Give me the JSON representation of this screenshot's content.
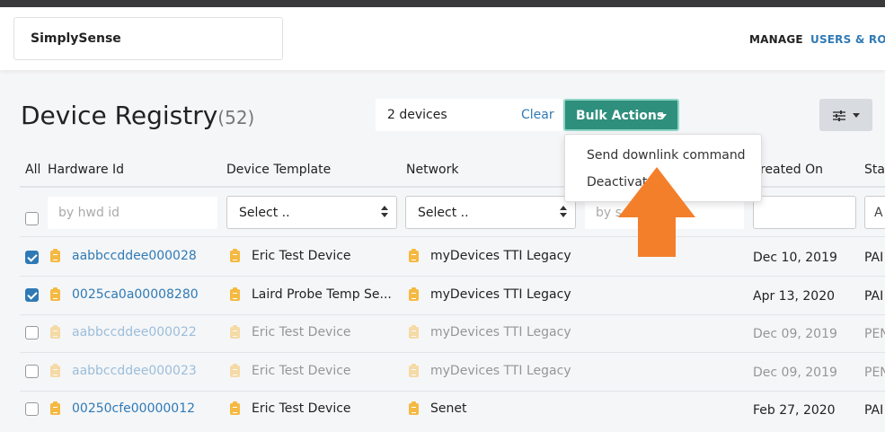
{
  "header": {
    "brand": "SimplySense",
    "nav": [
      "MANAGE",
      "USERS & ROLE"
    ]
  },
  "page": {
    "title": "Device Registry",
    "count": "(52)"
  },
  "selection": {
    "count_text": "2 devices",
    "clear_label": "Clear",
    "bulk_label": "Bulk Actions"
  },
  "bulk_menu": [
    "Send downlink command",
    "Deactivate"
  ],
  "columns": {
    "all": "All",
    "hardware_id": "Hardware Id",
    "device_template": "Device Template",
    "network": "Network",
    "created_on": "reated On",
    "status": "Stat"
  },
  "filters": {
    "hwd_placeholder": "by hwd id",
    "template_select": "Select ..",
    "network_select": "Select ..",
    "search_placeholder": "by s",
    "status_placeholder": "A"
  },
  "rows": [
    {
      "hw": "aabbccddee000028",
      "template": "Eric Test Device",
      "network": "myDevices TTI Legacy",
      "created": "Dec 10, 2019",
      "status": "PAI",
      "checked": true,
      "dim": false
    },
    {
      "hw": "0025ca0a00008280",
      "template": "Laird Probe Temp Se...",
      "network": "myDevices TTI Legacy",
      "created": "Apr 13, 2020",
      "status": "PAI",
      "checked": true,
      "dim": false
    },
    {
      "hw": "aabbccddee000022",
      "template": "Eric Test Device",
      "network": "myDevices TTI Legacy",
      "created": "Dec 09, 2019",
      "status": "PEN",
      "checked": false,
      "dim": true
    },
    {
      "hw": "aabbccddee000023",
      "template": "Eric Test Device",
      "network": "myDevices TTI Legacy",
      "created": "Dec 09, 2019",
      "status": "PEN",
      "checked": false,
      "dim": true
    },
    {
      "hw": "00250cfe00000012",
      "template": "Eric Test Device",
      "network": "Senet",
      "created": "Feb 27, 2020",
      "status": "PAI",
      "checked": false,
      "dim": false
    }
  ],
  "colors": {
    "accent": "#2f8f7d",
    "link": "#2f7ab5",
    "arrow": "#f47f2a",
    "clip": "#f5b942"
  },
  "icons": {
    "filter": "sliders-icon",
    "row": "clipboard-icon",
    "annotation": "arrow-up-icon"
  }
}
